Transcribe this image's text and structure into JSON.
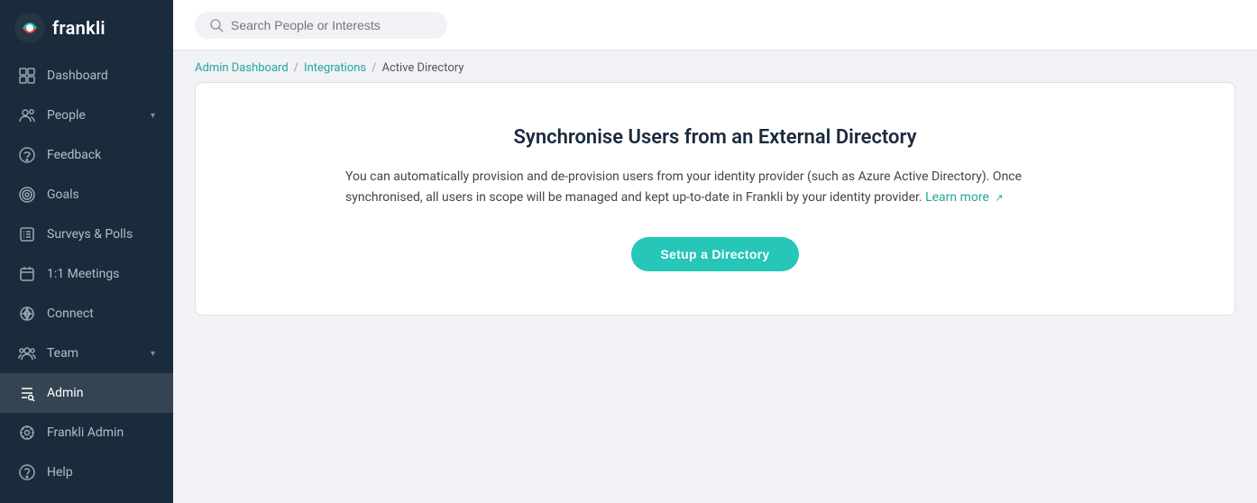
{
  "app": {
    "name": "frankli"
  },
  "search": {
    "placeholder": "Search People or Interests"
  },
  "breadcrumb": {
    "items": [
      {
        "label": "Admin Dashboard",
        "link": true
      },
      {
        "label": "Integrations",
        "link": true
      },
      {
        "label": "Active Directory",
        "link": false
      }
    ]
  },
  "page": {
    "title": "Synchronise Users from an External Directory",
    "description_part1": "You can automatically provision and de-provision users from your identity provider (such as Azure Active Directory). Once synchronised, all users in scope will be managed and kept up-to-date in Frankli by your identity provider.",
    "learn_more_label": "Learn more",
    "setup_button_label": "Setup a Directory"
  },
  "sidebar": {
    "items": [
      {
        "id": "dashboard",
        "label": "Dashboard",
        "icon": "dashboard-icon",
        "active": false,
        "chevron": false
      },
      {
        "id": "people",
        "label": "People",
        "icon": "people-icon",
        "active": false,
        "chevron": true
      },
      {
        "id": "feedback",
        "label": "Feedback",
        "icon": "feedback-icon",
        "active": false,
        "chevron": false
      },
      {
        "id": "goals",
        "label": "Goals",
        "icon": "goals-icon",
        "active": false,
        "chevron": false
      },
      {
        "id": "surveys",
        "label": "Surveys & Polls",
        "icon": "surveys-icon",
        "active": false,
        "chevron": false
      },
      {
        "id": "meetings",
        "label": "1:1 Meetings",
        "icon": "meetings-icon",
        "active": false,
        "chevron": false
      },
      {
        "id": "connect",
        "label": "Connect",
        "icon": "connect-icon",
        "active": false,
        "chevron": false
      },
      {
        "id": "team",
        "label": "Team",
        "icon": "team-icon",
        "active": false,
        "chevron": true
      },
      {
        "id": "admin",
        "label": "Admin",
        "icon": "admin-icon",
        "active": true,
        "chevron": false
      },
      {
        "id": "frankli-admin",
        "label": "Frankli Admin",
        "icon": "frankli-admin-icon",
        "active": false,
        "chevron": false
      },
      {
        "id": "help",
        "label": "Help",
        "icon": "help-icon",
        "active": false,
        "chevron": false
      }
    ]
  }
}
